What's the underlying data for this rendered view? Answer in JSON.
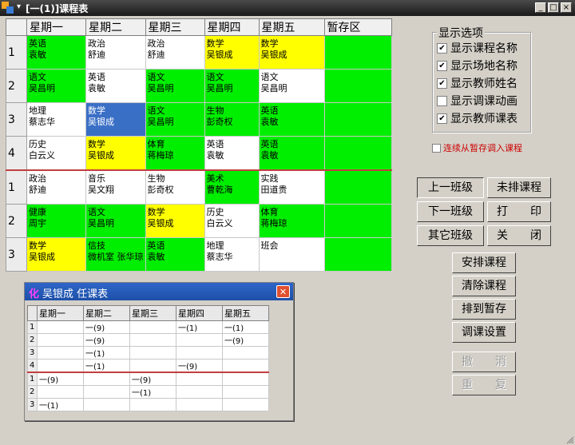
{
  "window": {
    "title": "[一(1)]课程表",
    "menu_glyph": "▾",
    "minimize": "_",
    "maximize": "□",
    "close": "×"
  },
  "timetable": {
    "headers": [
      "",
      "星期一",
      "星期二",
      "星期三",
      "星期四",
      "星期五",
      "暂存区"
    ],
    "rows": [
      {
        "period": "1",
        "cells": [
          {
            "course": "英语",
            "teacher": "袁敏",
            "color": "green"
          },
          {
            "course": "政治",
            "teacher": "舒迪",
            "color": "white"
          },
          {
            "course": "政治",
            "teacher": "舒迪",
            "color": "white"
          },
          {
            "course": "数学",
            "teacher": "吴银成",
            "color": "yellow"
          },
          {
            "course": "数学",
            "teacher": "吴银成",
            "color": "yellow"
          },
          {
            "course": "",
            "teacher": "",
            "color": "green"
          }
        ]
      },
      {
        "period": "2",
        "cells": [
          {
            "course": "语文",
            "teacher": "吴昌明",
            "color": "green"
          },
          {
            "course": "英语",
            "teacher": "袁敏",
            "color": "white"
          },
          {
            "course": "语文",
            "teacher": "吴昌明",
            "color": "green"
          },
          {
            "course": "语文",
            "teacher": "吴昌明",
            "color": "green"
          },
          {
            "course": "语文",
            "teacher": "吴昌明",
            "color": "white"
          },
          {
            "course": "",
            "teacher": "",
            "color": "green"
          }
        ]
      },
      {
        "period": "3",
        "cells": [
          {
            "course": "地理",
            "teacher": "蔡志华",
            "color": "white"
          },
          {
            "course": "数学",
            "teacher": "吴银成",
            "color": "sel"
          },
          {
            "course": "语文",
            "teacher": "吴昌明",
            "color": "green"
          },
          {
            "course": "生物",
            "teacher": "彭奇权",
            "color": "green"
          },
          {
            "course": "英语",
            "teacher": "袁敏",
            "color": "green"
          },
          {
            "course": "",
            "teacher": "",
            "color": "green"
          }
        ]
      },
      {
        "period": "4",
        "cells": [
          {
            "course": "历史",
            "teacher": "白云义",
            "color": "white"
          },
          {
            "course": "数学",
            "teacher": "吴银成",
            "color": "yellow"
          },
          {
            "course": "体育",
            "teacher": "蒋梅琼",
            "color": "green"
          },
          {
            "course": "英语",
            "teacher": "袁敏",
            "color": "white"
          },
          {
            "course": "英语",
            "teacher": "袁敏",
            "color": "green"
          },
          {
            "course": "",
            "teacher": "",
            "color": "green"
          }
        ]
      },
      {
        "period": "1",
        "sep": true,
        "cells": [
          {
            "course": "政治",
            "teacher": "舒迪",
            "color": "white"
          },
          {
            "course": "音乐",
            "teacher": "吴文翔",
            "color": "white"
          },
          {
            "course": "生物",
            "teacher": "彭奇权",
            "color": "white"
          },
          {
            "course": "美术",
            "teacher": "曹乾海",
            "color": "green"
          },
          {
            "course": "实践",
            "teacher": "田道贵",
            "color": "white"
          },
          {
            "course": "",
            "teacher": "",
            "color": "green"
          }
        ]
      },
      {
        "period": "2",
        "cells": [
          {
            "course": "健康",
            "teacher": "周宇",
            "color": "green"
          },
          {
            "course": "语文",
            "teacher": "吴昌明",
            "color": "green"
          },
          {
            "course": "数学",
            "teacher": "吴银成",
            "color": "yellow"
          },
          {
            "course": "历史",
            "teacher": "白云义",
            "color": "white"
          },
          {
            "course": "体育",
            "teacher": "蒋梅琼",
            "color": "green"
          },
          {
            "course": "",
            "teacher": "",
            "color": "green"
          }
        ]
      },
      {
        "period": "3",
        "cells": [
          {
            "course": "数学",
            "teacher": "吴银成",
            "color": "yellow"
          },
          {
            "course": "信技",
            "teacher": "微机室 张华琼",
            "color": "green"
          },
          {
            "course": "英语",
            "teacher": "袁敏",
            "color": "green"
          },
          {
            "course": "地理",
            "teacher": "蔡志华",
            "color": "white"
          },
          {
            "course": "班会",
            "teacher": "",
            "color": "white"
          },
          {
            "course": "",
            "teacher": "",
            "color": "green"
          }
        ]
      }
    ]
  },
  "options": {
    "title": "显示选项",
    "items": [
      {
        "label": "显示课程名称",
        "checked": true
      },
      {
        "label": "显示场地名称",
        "checked": true
      },
      {
        "label": "显示教师姓名",
        "checked": true
      },
      {
        "label": "显示调课动画",
        "checked": false
      },
      {
        "label": "显示教师课表",
        "checked": true
      }
    ],
    "transfer": {
      "label": "连续从暂存调入课程",
      "checked": false
    }
  },
  "buttons": {
    "prev_class": "上一班级",
    "unscheduled": "未排课程",
    "next_class": "下一班级",
    "print": "打　　印",
    "other_class": "其它班级",
    "close": "关　　闭",
    "arrange": "安排课程",
    "clear": "清除课程",
    "to_temp": "排到暂存",
    "adjust_settings": "调课设置",
    "undo": "撤　　消",
    "redo": "重　　复"
  },
  "teacher_window": {
    "title": "吴银成  任课表",
    "icon": "化",
    "close": "✕",
    "headers": [
      "",
      "星期一",
      "星期二",
      "星期三",
      "星期四",
      "星期五"
    ],
    "rows": [
      {
        "period": "1",
        "cells": [
          "",
          "一(9)",
          "",
          "一(1)",
          "一(1)"
        ]
      },
      {
        "period": "2",
        "cells": [
          "",
          "一(9)",
          "",
          "",
          "一(9)"
        ]
      },
      {
        "period": "3",
        "cells": [
          "",
          "一(1)",
          "",
          "",
          ""
        ]
      },
      {
        "period": "4",
        "cells": [
          "",
          "一(1)",
          "",
          "一(9)",
          ""
        ]
      },
      {
        "period": "1",
        "sep": true,
        "cells": [
          "一(9)",
          "",
          "一(9)",
          "",
          ""
        ]
      },
      {
        "period": "2",
        "cells": [
          "",
          "",
          "一(1)",
          "",
          ""
        ]
      },
      {
        "period": "3",
        "cells": [
          "一(1)",
          "",
          "",
          "",
          ""
        ]
      }
    ]
  },
  "colors": {
    "green": "#00ee00",
    "yellow": "#ffff00",
    "selected": "#3a6fc6",
    "titlebar": "#1a1a1a",
    "subtitlebar": "#2e66c8",
    "accent_red": "#cc0000"
  }
}
